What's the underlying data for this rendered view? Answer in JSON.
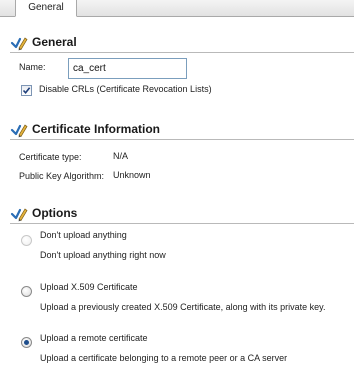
{
  "tabs": [
    {
      "label": "General",
      "active": true
    }
  ],
  "general": {
    "title": "General",
    "name_label": "Name:",
    "name_value": "ca_cert",
    "disable_crls_label": "Disable CRLs (Certificate Revocation Lists)",
    "disable_crls_checked": true
  },
  "cert_info": {
    "title": "Certificate Information",
    "type_label": "Certificate type:",
    "type_value": "N/A",
    "algorithm_label": "Public Key Algorithm:",
    "algorithm_value": "Unknown"
  },
  "options": {
    "title": "Options",
    "items": [
      {
        "label": "Don't upload anything",
        "description": "Don't upload anything right now",
        "selected": false,
        "enabled": false
      },
      {
        "label": "Upload X.509 Certificate",
        "description": "Upload a previously created X.509 Certificate, along with its private key.",
        "selected": false,
        "enabled": true
      },
      {
        "label": "Upload a remote certificate",
        "description": "Upload a certificate belonging to a remote peer or a CA server",
        "selected": true,
        "enabled": true
      }
    ]
  },
  "icons": {
    "section_icon": "pencil-check-icon",
    "accent": "#2a6db5"
  }
}
